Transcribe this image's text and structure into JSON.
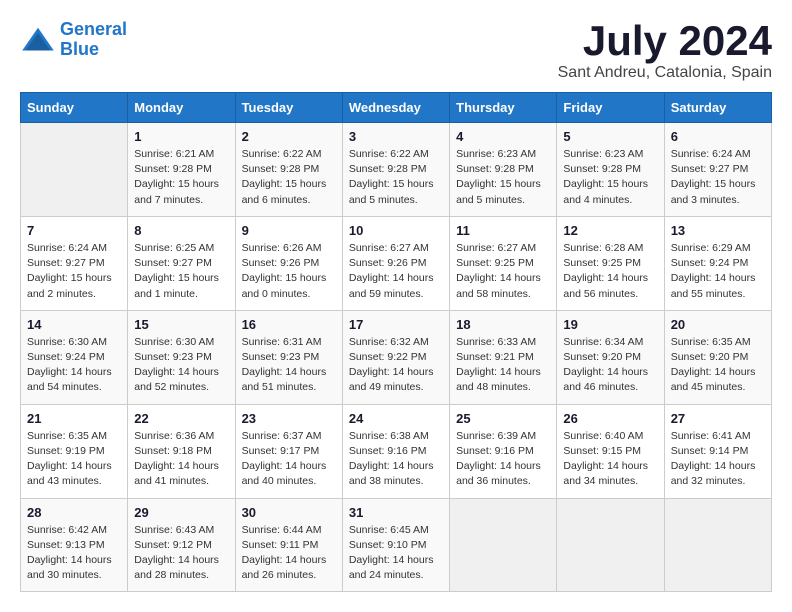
{
  "header": {
    "logo_line1": "General",
    "logo_line2": "Blue",
    "month": "July 2024",
    "location": "Sant Andreu, Catalonia, Spain"
  },
  "weekdays": [
    "Sunday",
    "Monday",
    "Tuesday",
    "Wednesday",
    "Thursday",
    "Friday",
    "Saturday"
  ],
  "weeks": [
    [
      {
        "day": "",
        "info": ""
      },
      {
        "day": "1",
        "info": "Sunrise: 6:21 AM\nSunset: 9:28 PM\nDaylight: 15 hours\nand 7 minutes."
      },
      {
        "day": "2",
        "info": "Sunrise: 6:22 AM\nSunset: 9:28 PM\nDaylight: 15 hours\nand 6 minutes."
      },
      {
        "day": "3",
        "info": "Sunrise: 6:22 AM\nSunset: 9:28 PM\nDaylight: 15 hours\nand 5 minutes."
      },
      {
        "day": "4",
        "info": "Sunrise: 6:23 AM\nSunset: 9:28 PM\nDaylight: 15 hours\nand 5 minutes."
      },
      {
        "day": "5",
        "info": "Sunrise: 6:23 AM\nSunset: 9:28 PM\nDaylight: 15 hours\nand 4 minutes."
      },
      {
        "day": "6",
        "info": "Sunrise: 6:24 AM\nSunset: 9:27 PM\nDaylight: 15 hours\nand 3 minutes."
      }
    ],
    [
      {
        "day": "7",
        "info": "Sunrise: 6:24 AM\nSunset: 9:27 PM\nDaylight: 15 hours\nand 2 minutes."
      },
      {
        "day": "8",
        "info": "Sunrise: 6:25 AM\nSunset: 9:27 PM\nDaylight: 15 hours\nand 1 minute."
      },
      {
        "day": "9",
        "info": "Sunrise: 6:26 AM\nSunset: 9:26 PM\nDaylight: 15 hours\nand 0 minutes."
      },
      {
        "day": "10",
        "info": "Sunrise: 6:27 AM\nSunset: 9:26 PM\nDaylight: 14 hours\nand 59 minutes."
      },
      {
        "day": "11",
        "info": "Sunrise: 6:27 AM\nSunset: 9:25 PM\nDaylight: 14 hours\nand 58 minutes."
      },
      {
        "day": "12",
        "info": "Sunrise: 6:28 AM\nSunset: 9:25 PM\nDaylight: 14 hours\nand 56 minutes."
      },
      {
        "day": "13",
        "info": "Sunrise: 6:29 AM\nSunset: 9:24 PM\nDaylight: 14 hours\nand 55 minutes."
      }
    ],
    [
      {
        "day": "14",
        "info": "Sunrise: 6:30 AM\nSunset: 9:24 PM\nDaylight: 14 hours\nand 54 minutes."
      },
      {
        "day": "15",
        "info": "Sunrise: 6:30 AM\nSunset: 9:23 PM\nDaylight: 14 hours\nand 52 minutes."
      },
      {
        "day": "16",
        "info": "Sunrise: 6:31 AM\nSunset: 9:23 PM\nDaylight: 14 hours\nand 51 minutes."
      },
      {
        "day": "17",
        "info": "Sunrise: 6:32 AM\nSunset: 9:22 PM\nDaylight: 14 hours\nand 49 minutes."
      },
      {
        "day": "18",
        "info": "Sunrise: 6:33 AM\nSunset: 9:21 PM\nDaylight: 14 hours\nand 48 minutes."
      },
      {
        "day": "19",
        "info": "Sunrise: 6:34 AM\nSunset: 9:20 PM\nDaylight: 14 hours\nand 46 minutes."
      },
      {
        "day": "20",
        "info": "Sunrise: 6:35 AM\nSunset: 9:20 PM\nDaylight: 14 hours\nand 45 minutes."
      }
    ],
    [
      {
        "day": "21",
        "info": "Sunrise: 6:35 AM\nSunset: 9:19 PM\nDaylight: 14 hours\nand 43 minutes."
      },
      {
        "day": "22",
        "info": "Sunrise: 6:36 AM\nSunset: 9:18 PM\nDaylight: 14 hours\nand 41 minutes."
      },
      {
        "day": "23",
        "info": "Sunrise: 6:37 AM\nSunset: 9:17 PM\nDaylight: 14 hours\nand 40 minutes."
      },
      {
        "day": "24",
        "info": "Sunrise: 6:38 AM\nSunset: 9:16 PM\nDaylight: 14 hours\nand 38 minutes."
      },
      {
        "day": "25",
        "info": "Sunrise: 6:39 AM\nSunset: 9:16 PM\nDaylight: 14 hours\nand 36 minutes."
      },
      {
        "day": "26",
        "info": "Sunrise: 6:40 AM\nSunset: 9:15 PM\nDaylight: 14 hours\nand 34 minutes."
      },
      {
        "day": "27",
        "info": "Sunrise: 6:41 AM\nSunset: 9:14 PM\nDaylight: 14 hours\nand 32 minutes."
      }
    ],
    [
      {
        "day": "28",
        "info": "Sunrise: 6:42 AM\nSunset: 9:13 PM\nDaylight: 14 hours\nand 30 minutes."
      },
      {
        "day": "29",
        "info": "Sunrise: 6:43 AM\nSunset: 9:12 PM\nDaylight: 14 hours\nand 28 minutes."
      },
      {
        "day": "30",
        "info": "Sunrise: 6:44 AM\nSunset: 9:11 PM\nDaylight: 14 hours\nand 26 minutes."
      },
      {
        "day": "31",
        "info": "Sunrise: 6:45 AM\nSunset: 9:10 PM\nDaylight: 14 hours\nand 24 minutes."
      },
      {
        "day": "",
        "info": ""
      },
      {
        "day": "",
        "info": ""
      },
      {
        "day": "",
        "info": ""
      }
    ]
  ]
}
